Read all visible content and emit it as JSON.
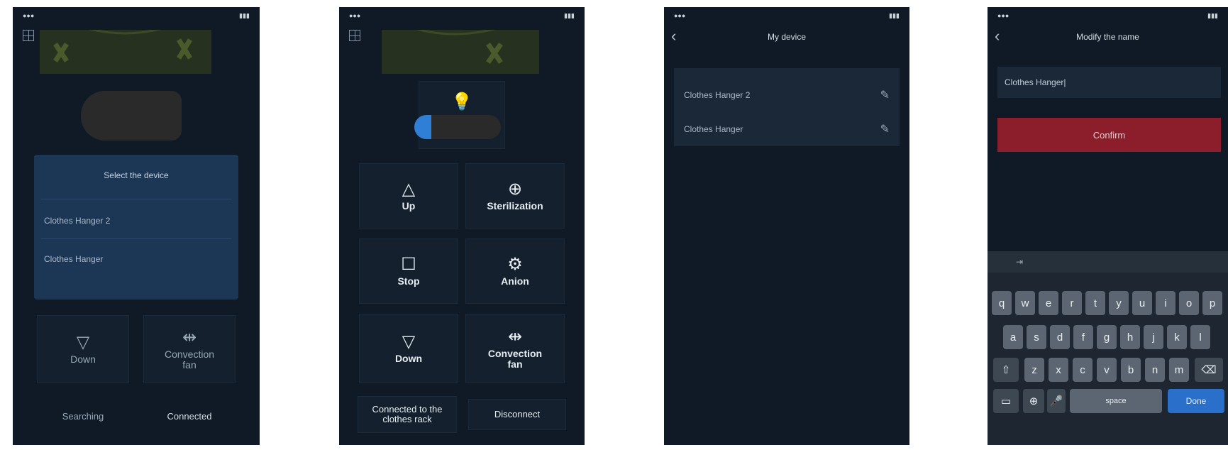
{
  "screen1": {
    "dialog_title": "Select the device",
    "devices": [
      "Clothes Hanger 2",
      "Clothes Hanger"
    ],
    "tiles": [
      {
        "label": "Down",
        "icon": "triangle-down-icon"
      },
      {
        "label": "Convection fan",
        "icon": "fan-icon"
      }
    ],
    "bottom": [
      "Searching",
      "Connected"
    ]
  },
  "screen2": {
    "tiles": [
      {
        "label": "Up",
        "icon": "triangle-up-icon"
      },
      {
        "label": "Sterilization",
        "icon": "target-icon"
      },
      {
        "label": "Stop",
        "icon": "square-stop-icon"
      },
      {
        "label": "Anion",
        "icon": "anion-icon"
      },
      {
        "label": "Down",
        "icon": "triangle-down-icon"
      },
      {
        "label": "Convection fan",
        "icon": "fan-icon"
      }
    ],
    "bottom": [
      "Connected to the clothes rack",
      "Disconnect"
    ]
  },
  "screen3": {
    "title": "My device",
    "devices": [
      "Clothes Hanger 2",
      "Clothes Hanger"
    ]
  },
  "screen4": {
    "title": "Modify the name",
    "input_value": "Clothes Hanger|",
    "confirm_label": "Confirm",
    "keyboard": {
      "row1": [
        "q",
        "w",
        "e",
        "r",
        "t",
        "y",
        "u",
        "i",
        "o",
        "p"
      ],
      "row2": [
        "a",
        "s",
        "d",
        "f",
        "g",
        "h",
        "j",
        "k",
        "l"
      ],
      "row3": [
        "z",
        "x",
        "c",
        "v",
        "b",
        "n",
        "m"
      ],
      "space_label": "space",
      "done_label": "Done"
    }
  },
  "colors": {
    "background": "#0f1a26",
    "dialog": "#1c3656",
    "confirm": "#8c1d2a",
    "done_key": "#2a6fc9",
    "slider_accent": "#2f7fd6"
  }
}
